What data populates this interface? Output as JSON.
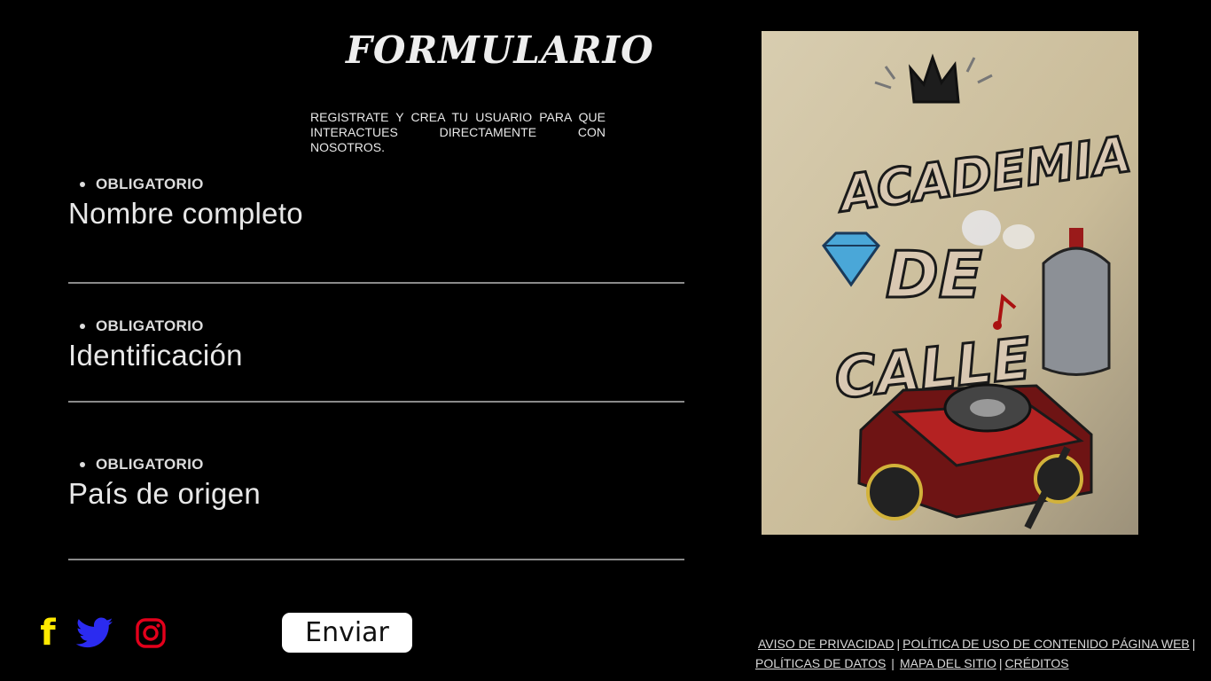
{
  "header": {
    "title": "FORMULARIO",
    "intro": "REGISTRATE Y CREA TU USUARIO PARA QUE INTERACTUES DIRECTAMENTE CON NOSOTROS."
  },
  "form": {
    "fields": [
      {
        "required_label": "OBLIGATORIO",
        "label": "Nombre completo"
      },
      {
        "required_label": "OBLIGATORIO",
        "label": "Identificación"
      },
      {
        "required_label": "OBLIGATORIO",
        "label": "País de origen"
      }
    ],
    "submit_label": "Enviar"
  },
  "social": {
    "facebook_glyph": "f",
    "icons": [
      "facebook-icon",
      "twitter-icon",
      "instagram-icon"
    ],
    "colors": {
      "facebook": "#ffe900",
      "twitter": "#2b2bf0",
      "instagram": "#e3001b"
    }
  },
  "artwork": {
    "text_lines": [
      "ACADEMIA",
      "DE",
      "CALLE"
    ]
  },
  "footer": {
    "links": [
      "AVISO DE PRIVACIDAD",
      "POLÍTICA DE USO DE CONTENIDO PÁGINA WEB",
      "POLÍTICAS DE DATOS",
      "MAPA DEL SITIO",
      "CRÉDITOS"
    ],
    "separator": "|"
  }
}
